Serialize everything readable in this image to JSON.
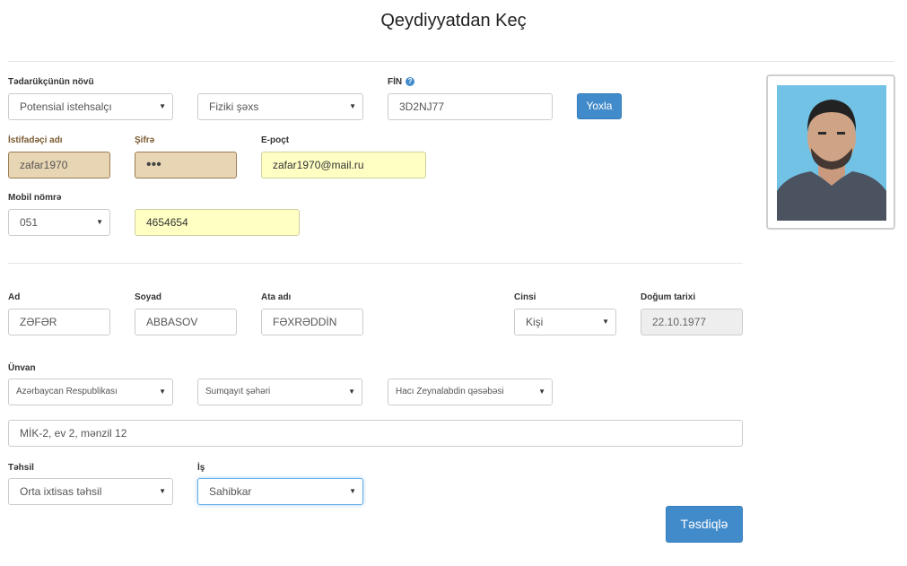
{
  "title": "Qeydiyyatdan Keç",
  "supplier": {
    "type_label": "Tədarükçünün növü",
    "type_value": "Potensial istehsalçı",
    "person_value": "Fiziki şəxs",
    "fin_label": "FİN",
    "fin_value": "3D2NJ77",
    "check_button": "Yoxla"
  },
  "account": {
    "username_label": "İstifadəçi adı",
    "username_value": "zafar1970",
    "password_label": "Şifrə",
    "password_value": "•••",
    "email_label": "E-poçt",
    "email_value": "zafar1970@mail.ru",
    "mobile_label": "Mobil nömrə",
    "mobile_prefix": "051",
    "mobile_number": "4654654"
  },
  "person": {
    "name_label": "Ad",
    "name_value": "ZƏFƏR",
    "surname_label": "Soyad",
    "surname_value": "ABBASOV",
    "father_label": "Ata adı",
    "father_value": "FƏXRƏDDİN",
    "gender_label": "Cinsi",
    "gender_value": "Kişi",
    "birth_label": "Doğum tarixi",
    "birth_value": "22.10.1977"
  },
  "address": {
    "label": "Ünvan",
    "country": "Azərbaycan Respublikası",
    "city": "Sumqayıt şəhəri",
    "settlement": "Hacı Zeynalabdin qəsəbəsi",
    "street": "MİK-2, ev 2, mənzil 12"
  },
  "education": {
    "label": "Təhsil",
    "value": "Orta ixtisas təhsil"
  },
  "work": {
    "label": "İş",
    "value": "Sahibkar"
  },
  "submit_button": "Təsdiqlə",
  "icons": {
    "caret": "▼",
    "help": "?"
  },
  "colors": {
    "primary": "#428bca",
    "highlight_yellow": "#ffffc4",
    "readonly_tan": "#e8d5b3"
  }
}
